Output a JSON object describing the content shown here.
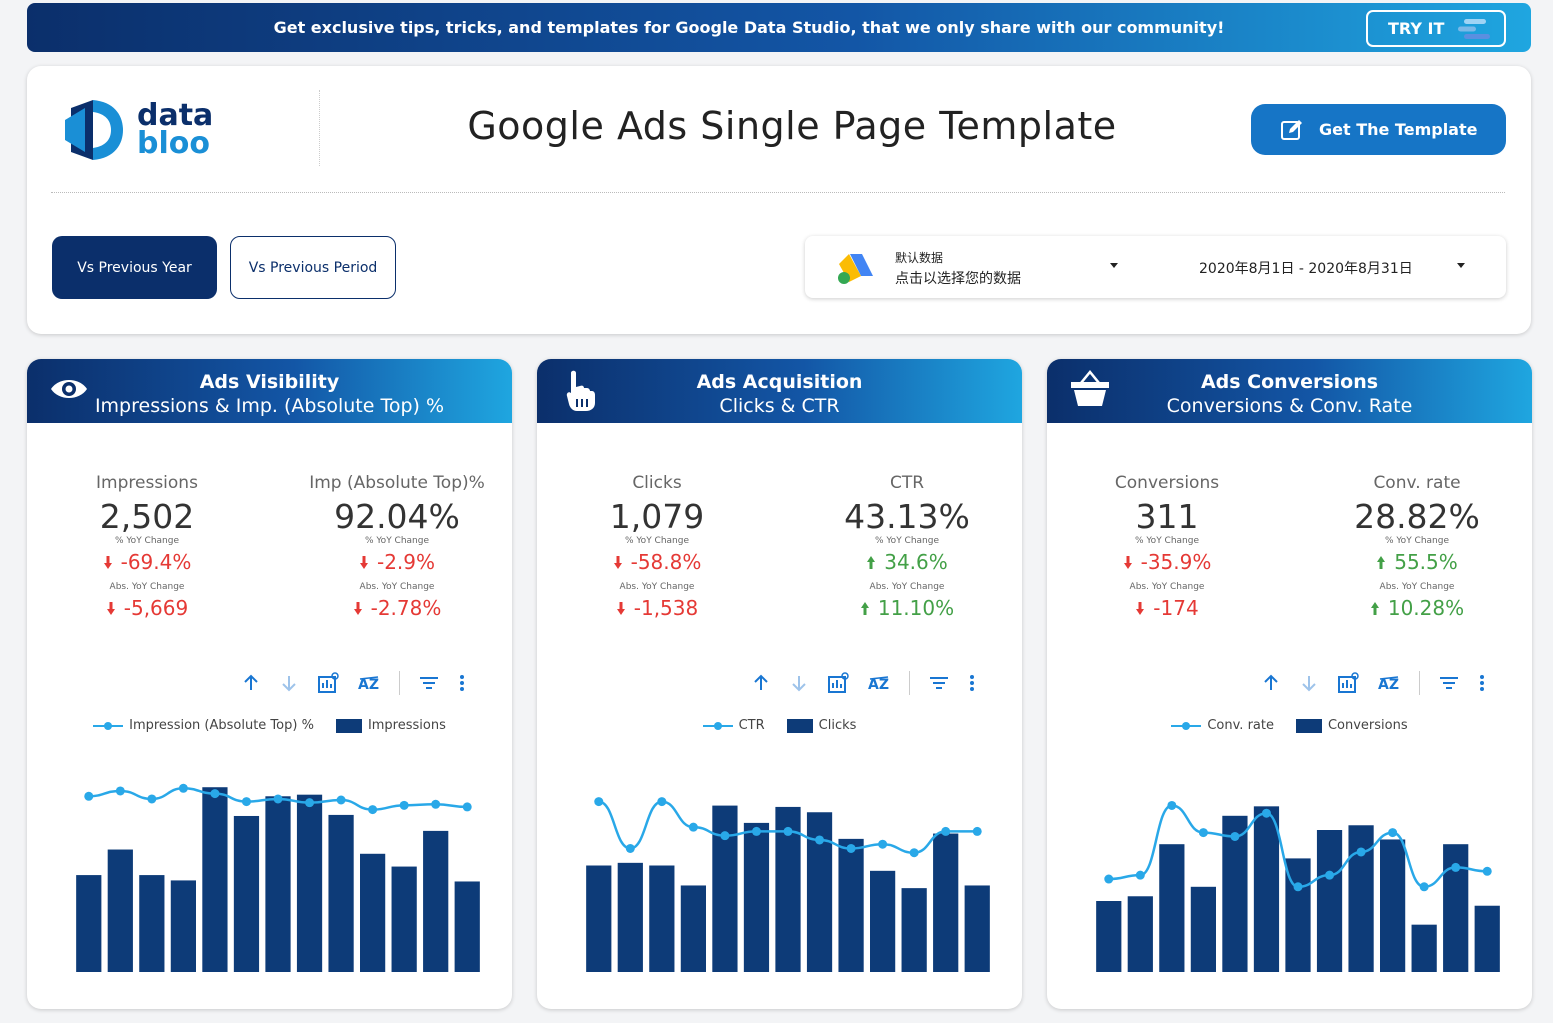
{
  "promo": {
    "text": "Get exclusive tips, tricks, and templates for Google Data Studio, that we only share with our community!",
    "button": "TRY IT"
  },
  "header": {
    "logo_line1": "data",
    "logo_line2": "bloo",
    "title": "Google Ads Single Page Template",
    "get_template": "Get The Template"
  },
  "comparison": {
    "vs_year": "Vs Previous Year",
    "vs_period": "Vs Previous Period"
  },
  "data_source": {
    "line1": "默认数据",
    "line2": "点击以选择您的数据"
  },
  "date_range": "2020年8月1日 - 2020年8月31日",
  "colors": {
    "navy": "#0b2f6b",
    "bar": "#0d3b78",
    "line": "#29a8e8",
    "negative": "#e53935",
    "positive": "#43a047",
    "accent": "#1675c6"
  },
  "panels": [
    {
      "icon": "eye-icon",
      "title": "Ads Visibility",
      "subtitle": "Impressions & Imp. (Absolute Top) %",
      "metrics": [
        {
          "label": "Impressions",
          "value": "2,502",
          "pct_label": "% YoY Change",
          "pct": "-69.4%",
          "pct_dir": "down",
          "abs_label": "Abs. YoY Change",
          "abs": "-5,669",
          "abs_dir": "down"
        },
        {
          "label": "Imp (Absolute Top)%",
          "value": "92.04%",
          "pct_label": "% YoY Change",
          "pct": "-2.9%",
          "pct_dir": "down",
          "abs_label": "Abs. YoY Change",
          "abs": "-2.78%",
          "abs_dir": "down"
        }
      ]
    },
    {
      "icon": "pointer-hand-icon",
      "title": "Ads Acquisition",
      "subtitle": "Clicks & CTR",
      "metrics": [
        {
          "label": "Clicks",
          "value": "1,079",
          "pct_label": "% YoY Change",
          "pct": "-58.8%",
          "pct_dir": "down",
          "abs_label": "Abs. YoY Change",
          "abs": "-1,538",
          "abs_dir": "down"
        },
        {
          "label": "CTR",
          "value": "43.13%",
          "pct_label": "% YoY Change",
          "pct": "34.6%",
          "pct_dir": "up",
          "abs_label": "Abs. YoY Change",
          "abs": "11.10%",
          "abs_dir": "up"
        }
      ]
    },
    {
      "icon": "basket-icon",
      "title": "Ads Conversions",
      "subtitle": "Conversions & Conv. Rate",
      "metrics": [
        {
          "label": "Conversions",
          "value": "311",
          "pct_label": "% YoY Change",
          "pct": "-35.9%",
          "pct_dir": "down",
          "abs_label": "Abs. YoY Change",
          "abs": "-174",
          "abs_dir": "down"
        },
        {
          "label": "Conv. rate",
          "value": "28.82%",
          "pct_label": "% YoY Change",
          "pct": "55.5%",
          "pct_dir": "up",
          "abs_label": "Abs. YoY Change",
          "abs": "10.28%",
          "abs_dir": "up"
        }
      ]
    }
  ],
  "chart_data": [
    {
      "type": "bar",
      "series": [
        {
          "name": "Impressions",
          "kind": "bar",
          "values": [
            182,
            230,
            182,
            172,
            347,
            293,
            330,
            333,
            295,
            222,
            198,
            265,
            170
          ]
        },
        {
          "name": "Impression (Absolute Top) %",
          "kind": "line",
          "values": [
            93.0,
            94.0,
            92.5,
            94.5,
            93.5,
            92.0,
            92.5,
            91.8,
            92.3,
            90.5,
            91.3,
            91.5,
            91.0
          ]
        }
      ],
      "bar_max": 400,
      "line_range": [
        60,
        100
      ]
    },
    {
      "type": "bar",
      "series": [
        {
          "name": "Clicks",
          "kind": "bar",
          "values": [
            80,
            82,
            80,
            65,
            125,
            112,
            124,
            120,
            100,
            76,
            63,
            104,
            65
          ]
        },
        {
          "name": "CTR",
          "kind": "line",
          "values": [
            50,
            39,
            50,
            44,
            42,
            43,
            43,
            41,
            39,
            40,
            38,
            43,
            43
          ]
        }
      ],
      "bar_max": 160,
      "line_range": [
        10,
        60
      ]
    },
    {
      "type": "bar",
      "series": [
        {
          "name": "Conversions",
          "kind": "bar",
          "values": [
            15,
            16,
            27,
            18,
            33,
            35,
            24,
            30,
            31,
            28,
            10,
            27,
            14
          ]
        },
        {
          "name": "Conv. rate",
          "kind": "line",
          "values": [
            24,
            25,
            43,
            36,
            35,
            41,
            22,
            25,
            31,
            36,
            22,
            27,
            26
          ]
        }
      ],
      "bar_max": 45,
      "line_range": [
        0,
        55
      ]
    }
  ]
}
